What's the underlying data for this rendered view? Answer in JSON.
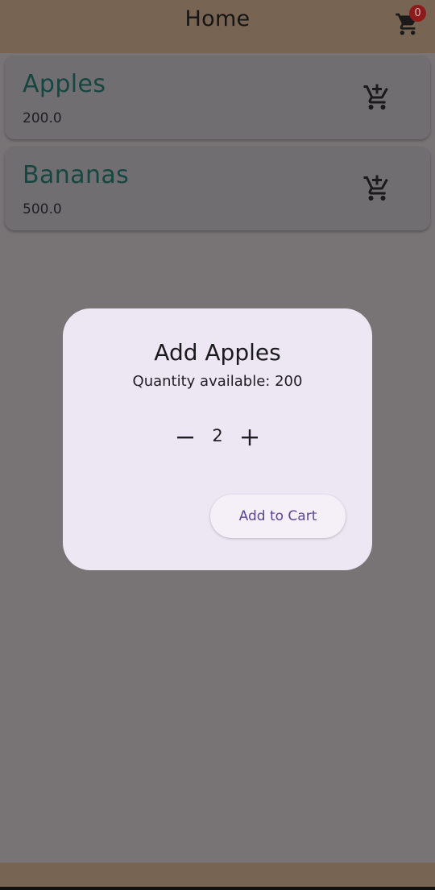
{
  "app_bar": {
    "title": "Home",
    "cart_icon": "shopping-cart-icon",
    "cart_count": "0"
  },
  "products": [
    {
      "name": "Apples",
      "price": "200.0",
      "icon": "add-shopping-cart-icon"
    },
    {
      "name": "Bananas",
      "price": "500.0",
      "icon": "add-shopping-cart-icon"
    }
  ],
  "dialog": {
    "title": "Add Apples",
    "subtitle": "Quantity available: 200",
    "quantity": "2",
    "decrement_icon": "minus-icon",
    "increment_icon": "plus-icon",
    "add_to_cart_label": "Add to Cart"
  },
  "colors": {
    "app_bar_bg": "#776452",
    "scrim_bg": "#787476",
    "product_name": "#164641",
    "dialog_bg": "#ede7f4",
    "button_text": "#5d4595",
    "badge_bg": "#8e1b1b"
  }
}
